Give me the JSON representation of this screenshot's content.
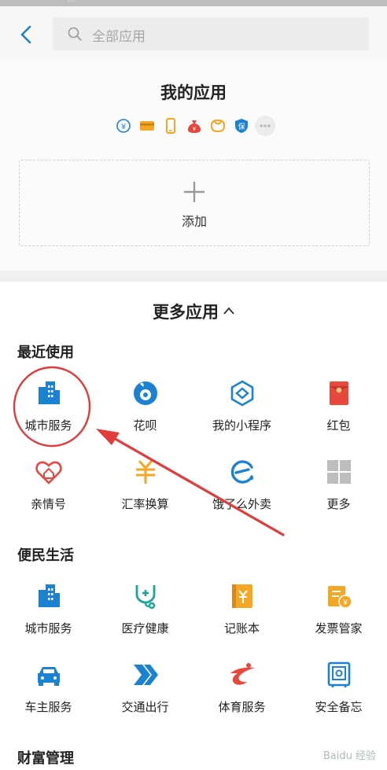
{
  "header": {
    "back_label": "返回",
    "search_placeholder": "全部应用"
  },
  "mine": {
    "title": "我的应用",
    "add_label": "添加",
    "mini_icons": [
      "exchange-icon",
      "card-icon",
      "phone-icon",
      "money-bag-icon",
      "coupon-icon",
      "insurance-icon",
      "more-dots-icon"
    ],
    "insurance_char": "保",
    "yen_char": "¥"
  },
  "more": {
    "title": "更多应用",
    "sections": [
      {
        "title": "最近使用",
        "items": [
          {
            "label": "城市服务",
            "icon": "city-building-icon"
          },
          {
            "label": "花呗",
            "icon": "huabei-icon"
          },
          {
            "label": "我的小程序",
            "icon": "mini-program-icon"
          },
          {
            "label": "红包",
            "icon": "red-envelope-icon"
          },
          {
            "label": "亲情号",
            "icon": "family-heart-icon"
          },
          {
            "label": "汇率换算",
            "icon": "exchange-rate-icon"
          },
          {
            "label": "饿了么外卖",
            "icon": "eleme-icon"
          },
          {
            "label": "更多",
            "icon": "more-grid-icon"
          }
        ]
      },
      {
        "title": "便民生活",
        "items": [
          {
            "label": "城市服务",
            "icon": "city-building-icon"
          },
          {
            "label": "医疗健康",
            "icon": "medical-icon"
          },
          {
            "label": "记账本",
            "icon": "ledger-icon"
          },
          {
            "label": "发票管家",
            "icon": "invoice-icon"
          },
          {
            "label": "车主服务",
            "icon": "car-icon"
          },
          {
            "label": "交通出行",
            "icon": "transport-icon"
          },
          {
            "label": "体育服务",
            "icon": "sports-icon"
          },
          {
            "label": "安全备忘",
            "icon": "safe-icon"
          }
        ]
      },
      {
        "title": "财富管理",
        "items": []
      }
    ]
  },
  "colors": {
    "blue": "#1b82d2",
    "orange": "#f5a623",
    "red": "#e8473c",
    "grey": "#bdbdbd"
  },
  "watermark": "Baidu 经验"
}
